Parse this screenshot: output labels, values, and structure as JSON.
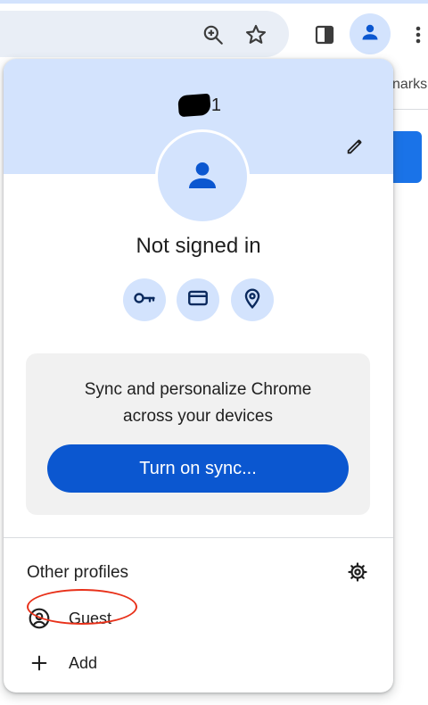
{
  "colors": {
    "accent": "#0b57d0",
    "header_bg": "#d3e3fd",
    "card_bg": "#f1f1f1",
    "annotation": "#e8311a"
  },
  "toolbar": {
    "icons": [
      "zoom-icon",
      "bookmark-star-icon",
      "side-panel-icon",
      "profile-icon",
      "more-menu-icon"
    ]
  },
  "background": {
    "bookmarks_fragment": "narks"
  },
  "profile": {
    "name_suffix": "1",
    "status": "Not signed in",
    "quick_actions": [
      "passwords-key-icon",
      "payment-card-icon",
      "addresses-location-icon"
    ]
  },
  "sync": {
    "message_line1": "Sync and personalize Chrome",
    "message_line2": "across your devices",
    "button_label": "Turn on sync..."
  },
  "other_profiles": {
    "title": "Other profiles",
    "items": [
      {
        "label": "Guest",
        "icon": "guest-account-icon"
      },
      {
        "label": "Add",
        "icon": "plus-icon"
      }
    ]
  }
}
